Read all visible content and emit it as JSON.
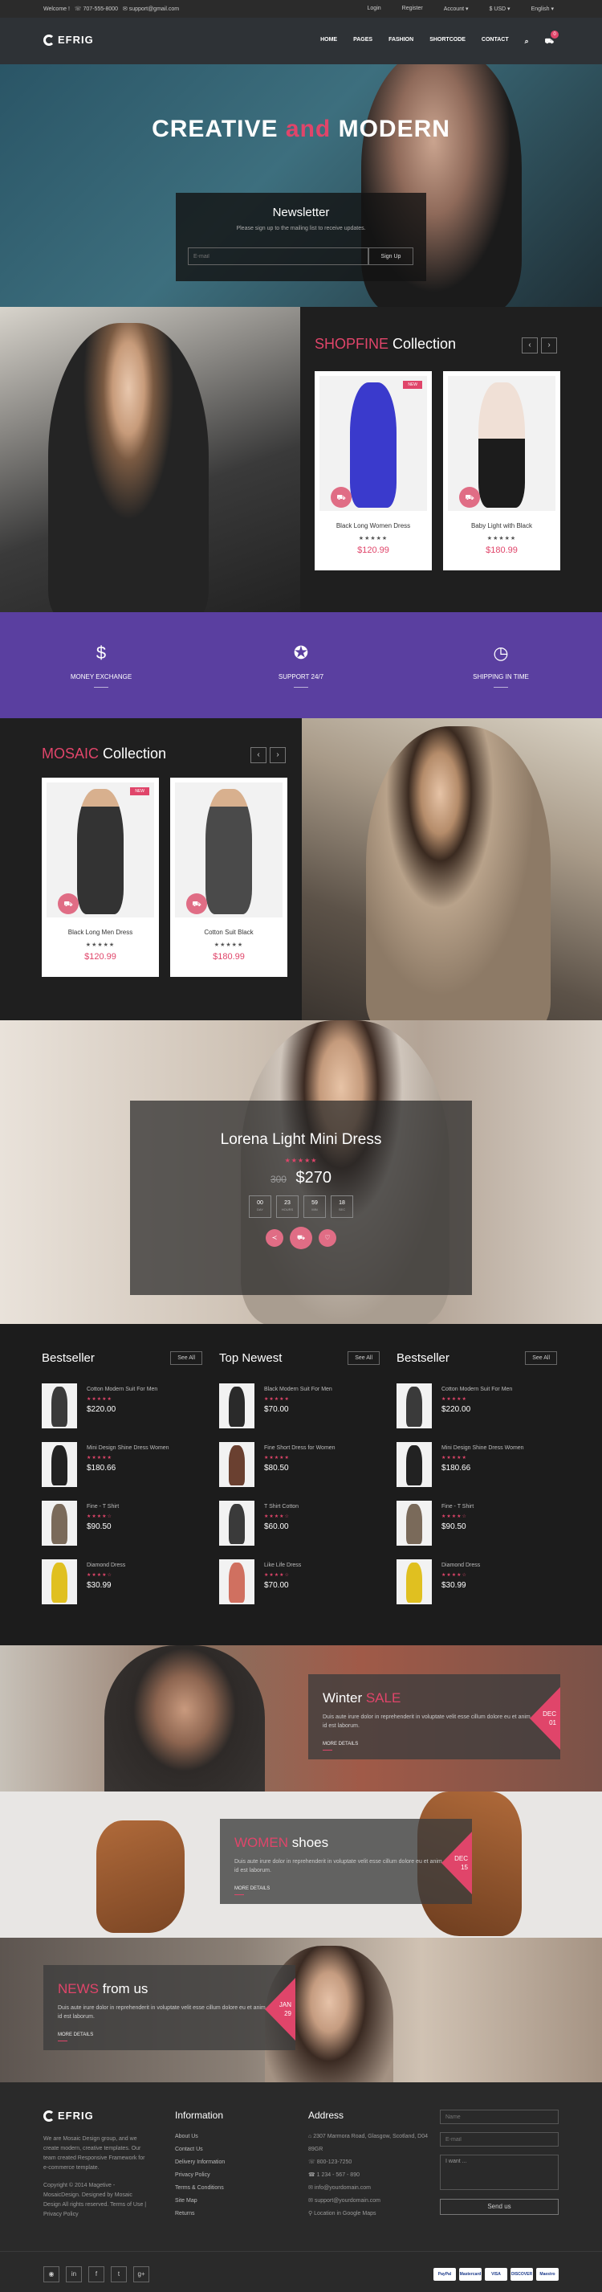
{
  "topbar": {
    "welcome": "Welcome !",
    "phone": "☏ 707-555-8000",
    "email": "✉ support@gmail.com",
    "login": "Login",
    "register": "Register",
    "account": "Account ▾",
    "currency": "$ USD ▾",
    "language": "English ▾"
  },
  "header": {
    "logo": "EFRIG",
    "nav": [
      "HOME",
      "PAGES",
      "FASHION",
      "SHORTCODE",
      "CONTACT"
    ],
    "cart_count": "0"
  },
  "hero": {
    "title_1": "CREATIVE",
    "title_and": "and",
    "title_2": "MODERN",
    "newsletter_title": "Newsletter",
    "newsletter_text": "Please sign up to the mailing list to receive updates.",
    "email_placeholder": "E-mail",
    "signup_label": "Sign Up"
  },
  "shopfine": {
    "title_accent": "SHOPFINE",
    "title_rest": " Collection",
    "products": [
      {
        "name": "Black Long Women Dress",
        "rating": "★★★★★",
        "price": "$120.99",
        "badge": "NEW",
        "color": "#3a3acc"
      },
      {
        "name": "Baby Light with Black",
        "rating": "★★★★★",
        "price": "$180.99",
        "badge": "",
        "color": "#1c1c1c"
      }
    ]
  },
  "services": [
    {
      "icon": "dollar-icon",
      "glyph": "$",
      "label": "MONEY EXCHANGE"
    },
    {
      "icon": "support-icon",
      "glyph": "✪",
      "label": "SUPPORT 24/7"
    },
    {
      "icon": "clock-icon",
      "glyph": "◷",
      "label": "SHIPPING IN TIME"
    }
  ],
  "mosaic": {
    "title_accent": "MOSAIC",
    "title_rest": " Collection",
    "products": [
      {
        "name": "Black Long Men Dress",
        "rating": "★★★★★",
        "price": "$120.99",
        "badge": "NEW",
        "color": "#333333"
      },
      {
        "name": "Cotton Suit Black",
        "rating": "★★★★★",
        "price": "$180.99",
        "badge": "",
        "color": "#4a4a4a"
      }
    ]
  },
  "featured": {
    "title": "Lorena Light Mini Dress",
    "rating": "★★★★★",
    "old_price": "300",
    "price": "$270",
    "countdown": [
      {
        "value": "00",
        "unit": "DAY"
      },
      {
        "value": "23",
        "unit": "HOURS"
      },
      {
        "value": "59",
        "unit": "MIN"
      },
      {
        "value": "18",
        "unit": "SEC"
      }
    ]
  },
  "lists": [
    {
      "title": "Bestseller",
      "see_all": "See All",
      "items": [
        {
          "name": "Cotton Modern Suit For Men",
          "stars": "★★★★★",
          "price": "$220.00",
          "color": "#3a3a3a"
        },
        {
          "name": "Mini Design Shine Dress Women",
          "stars": "★★★★★",
          "price": "$180.66",
          "color": "#222222"
        },
        {
          "name": "Fine - T Shirt",
          "stars": "★★★★☆",
          "price": "$90.50",
          "color": "#7a6a5a"
        },
        {
          "name": "Diamond Dress",
          "stars": "★★★★☆",
          "price": "$30.99",
          "color": "#e0c020"
        }
      ]
    },
    {
      "title": "Top Newest",
      "see_all": "See All",
      "items": [
        {
          "name": "Black Modern Suit For Men",
          "stars": "★★★★★",
          "price": "$70.00",
          "color": "#2a2a2a"
        },
        {
          "name": "Fine Short Dress for Women",
          "stars": "★★★★★",
          "price": "$80.50",
          "color": "#6a4030"
        },
        {
          "name": "T Shirt Cotton",
          "stars": "★★★★☆",
          "price": "$60.00",
          "color": "#3a3a3a"
        },
        {
          "name": "Like Life Dress",
          "stars": "★★★★☆",
          "price": "$70.00",
          "color": "#d07060"
        }
      ]
    },
    {
      "title": "Bestseller",
      "see_all": "See All",
      "items": [
        {
          "name": "Cotton Modern Suit For Men",
          "stars": "★★★★★",
          "price": "$220.00",
          "color": "#3a3a3a"
        },
        {
          "name": "Mini Design Shine Dress Women",
          "stars": "★★★★★",
          "price": "$180.66",
          "color": "#222222"
        },
        {
          "name": "Fine - T Shirt",
          "stars": "★★★★☆",
          "price": "$90.50",
          "color": "#7a6a5a"
        },
        {
          "name": "Diamond Dress",
          "stars": "★★★★☆",
          "price": "$30.99",
          "color": "#e0c020"
        }
      ]
    }
  ],
  "banners": [
    {
      "title_1": "Winter ",
      "title_accent": "SALE",
      "title_2": "",
      "text": "Duis aute irure dolor in reprehenderit in voluptate velit esse cillum dolore eu et anim id est laborum.",
      "more": "MORE DETAILS",
      "month": "DEC",
      "day": "01"
    },
    {
      "title_1": "",
      "title_accent": "WOMEN",
      "title_2": " shoes",
      "text": "Duis aute irure dolor in reprehenderit in voluptate velit esse cillum dolore eu et anim id est laborum.",
      "more": "MORE DETAILS",
      "month": "DEC",
      "day": "15"
    },
    {
      "title_1": "",
      "title_accent": "NEWS",
      "title_2": " from us",
      "text": "Duis aute irure dolor in reprehenderit in voluptate velit esse cillum dolore eu et anim id est laborum.",
      "more": "MORE DETAILS",
      "month": "JAN",
      "day": "29"
    }
  ],
  "footer": {
    "logo": "EFRIG",
    "about": "We are Mosaic Design group, and we create modern, creative templates. Our team created Responsive Framework for e-commerce template.",
    "copyright": "Copyright © 2014 Magetive - MosaicDesign. Designed by Mosaic Design All rights reserved. Terms of Use | Privacy Policy",
    "info_title": "Information",
    "info_links": [
      "About Us",
      "Contact Us",
      "Delivery Information",
      "Privacy Policy",
      "Terms & Conditions",
      "Site Map",
      "Returns"
    ],
    "address_title": "Address",
    "address_lines": [
      "2307 Marmora Road, Glasgow, Scotland, D04 89GR",
      "800-123-7250",
      "1 234 - 567 - 890",
      "info@yourdomain.com",
      "support@yourdomain.com",
      "Location in Google Maps"
    ],
    "form": {
      "name": "Name",
      "email": "E-mail",
      "message": "I want ...",
      "send": "Send us"
    },
    "social": [
      "◉",
      "in",
      "f",
      "t",
      "g+"
    ],
    "payments": [
      "PayPal",
      "Mastercard",
      "VISA",
      "DISCOVER",
      "Maestro"
    ]
  },
  "colors": {
    "accent": "#e0456a",
    "purple": "#5a3fa0"
  }
}
